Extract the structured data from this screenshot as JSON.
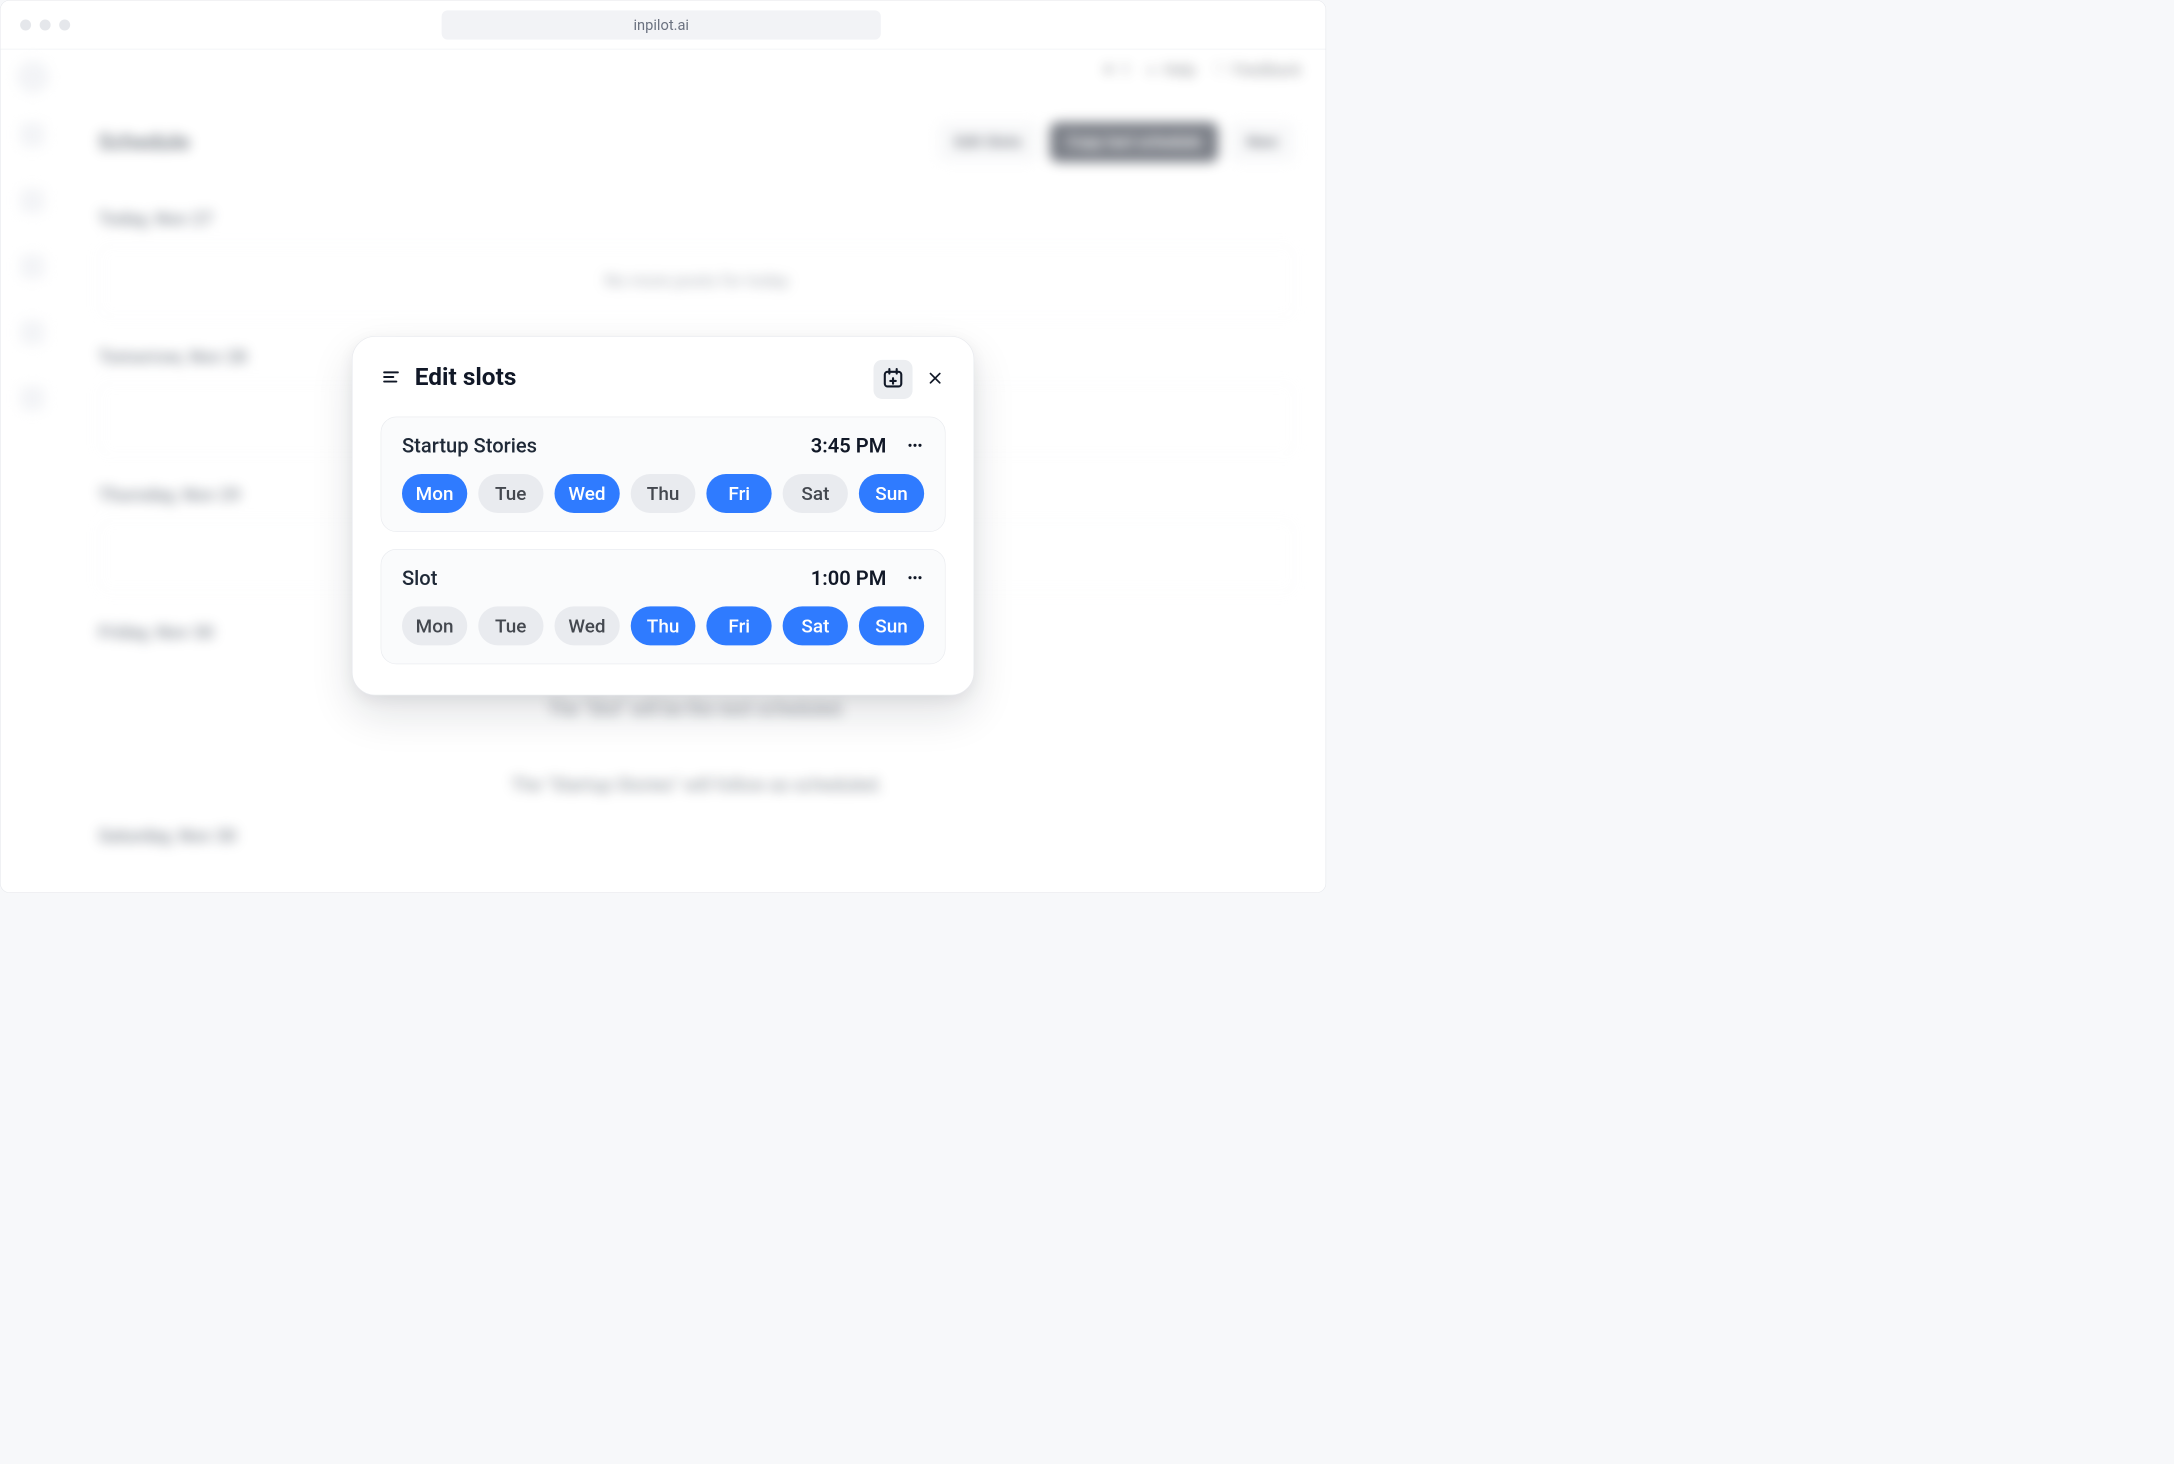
{
  "browser": {
    "address": "inpilot.ai"
  },
  "topnav": {
    "credits": "1",
    "help": "Help",
    "feedback": "Feedback"
  },
  "page": {
    "title": "Schedule",
    "actions": {
      "edit_slots": "Edit Slots",
      "copy": "Copy last schedule",
      "new": "New"
    },
    "days": {
      "today": "Today, Nov 27",
      "today_card": "No more posts for today",
      "tomorrow": "Tomorrow, Nov 28",
      "thursday": "Thursday, Nov 29",
      "friday": "Friday, Nov 30",
      "saturday": "Saturday, Nov 30"
    },
    "tip1": "The \"Slot\" will be the next scheduled.",
    "tip2": "The \"Startup Stories\" will follow as scheduled."
  },
  "modal": {
    "title": "Edit slots",
    "slots": [
      {
        "name": "Startup Stories",
        "time": "3:45 PM",
        "days": {
          "mon": "Mon",
          "tue": "Tue",
          "wed": "Wed",
          "thu": "Thu",
          "fri": "Fri",
          "sat": "Sat",
          "sun": "Sun"
        },
        "active": {
          "mon": true,
          "tue": false,
          "wed": true,
          "thu": false,
          "fri": true,
          "sat": false,
          "sun": true
        }
      },
      {
        "name": "Slot",
        "time": "1:00 PM",
        "days": {
          "mon": "Mon",
          "tue": "Tue",
          "wed": "Wed",
          "thu": "Thu",
          "fri": "Fri",
          "sat": "Sat",
          "sun": "Sun"
        },
        "active": {
          "mon": false,
          "tue": false,
          "wed": false,
          "thu": true,
          "fri": true,
          "sat": true,
          "sun": true
        }
      }
    ]
  },
  "colors": {
    "accent": "#2f7bff",
    "pill_off": "#e9ebef",
    "text": "#111827"
  }
}
